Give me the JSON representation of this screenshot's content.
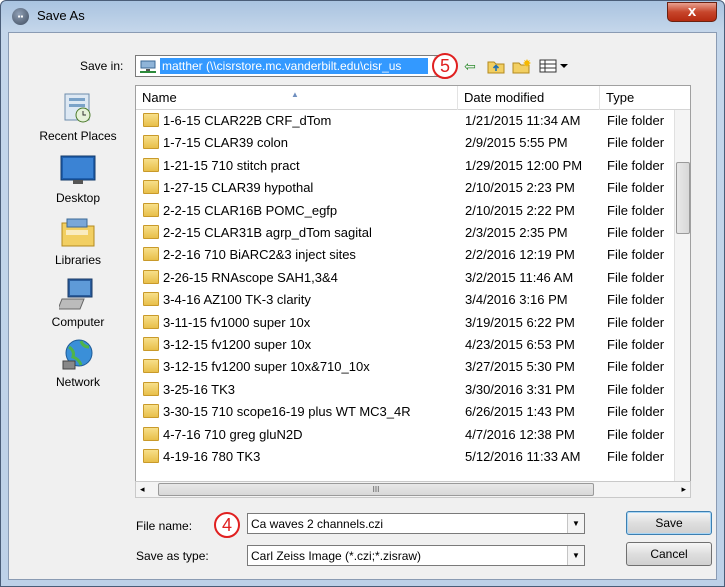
{
  "window": {
    "title": "Save As",
    "close_label": "x"
  },
  "save_in": {
    "label": "Save in:",
    "value": "matther (\\\\cisrstore.mc.vanderbilt.edu\\cisr_us"
  },
  "callouts": {
    "top": "5",
    "bottom": "4"
  },
  "places": [
    {
      "label": "Recent Places",
      "icon": "recent-places-icon"
    },
    {
      "label": "Desktop",
      "icon": "desktop-icon"
    },
    {
      "label": "Libraries",
      "icon": "libraries-icon"
    },
    {
      "label": "Computer",
      "icon": "computer-icon"
    },
    {
      "label": "Network",
      "icon": "network-icon"
    }
  ],
  "columns": {
    "name": "Name",
    "date": "Date modified",
    "type": "Type"
  },
  "files": [
    {
      "name": "1-6-15 CLAR22B CRF_dTom",
      "date": "1/21/2015 11:34 AM",
      "type": "File folder"
    },
    {
      "name": "1-7-15 CLAR39 colon",
      "date": "2/9/2015 5:55 PM",
      "type": "File folder"
    },
    {
      "name": "1-21-15 710 stitch pract",
      "date": "1/29/2015 12:00 PM",
      "type": "File folder"
    },
    {
      "name": "1-27-15 CLAR39 hypothal",
      "date": "2/10/2015 2:23 PM",
      "type": "File folder"
    },
    {
      "name": "2-2-15 CLAR16B POMC_egfp",
      "date": "2/10/2015 2:22 PM",
      "type": "File folder"
    },
    {
      "name": "2-2-15 CLAR31B agrp_dTom sagital",
      "date": "2/3/2015 2:35 PM",
      "type": "File folder"
    },
    {
      "name": "2-2-16 710 BiARC2&3 inject sites",
      "date": "2/2/2016 12:19 PM",
      "type": "File folder"
    },
    {
      "name": "2-26-15 RNAscope SAH1,3&4",
      "date": "3/2/2015 11:46 AM",
      "type": "File folder"
    },
    {
      "name": "3-4-16 AZ100 TK-3 clarity",
      "date": "3/4/2016 3:16 PM",
      "type": "File folder"
    },
    {
      "name": "3-11-15 fv1000 super 10x",
      "date": "3/19/2015 6:22 PM",
      "type": "File folder"
    },
    {
      "name": "3-12-15 fv1200 super 10x",
      "date": "4/23/2015 6:53 PM",
      "type": "File folder"
    },
    {
      "name": "3-12-15 fv1200 super 10x&710_10x",
      "date": "3/27/2015 5:30 PM",
      "type": "File folder"
    },
    {
      "name": "3-25-16 TK3",
      "date": "3/30/2016 3:31 PM",
      "type": "File folder"
    },
    {
      "name": "3-30-15 710 scope16-19 plus WT MC3_4R",
      "date": "6/26/2015 1:43 PM",
      "type": "File folder"
    },
    {
      "name": "4-7-16 710 greg gluN2D",
      "date": "4/7/2016 12:38 PM",
      "type": "File folder"
    },
    {
      "name": "4-19-16 780 TK3",
      "date": "5/12/2016 11:33 AM",
      "type": "File folder"
    }
  ],
  "file_name": {
    "label": "File name:",
    "value": "Ca waves 2 channels.czi"
  },
  "save_as_type": {
    "label": "Save as type:",
    "value": "Carl Zeiss Image (*.czi;*.zisraw)"
  },
  "buttons": {
    "save": "Save",
    "cancel": "Cancel"
  },
  "hscroll_grip": "III"
}
